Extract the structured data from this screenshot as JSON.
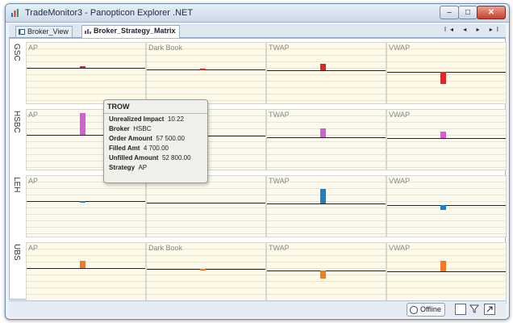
{
  "window": {
    "title": "TradeMonitor3 - Panopticon Explorer .NET",
    "minimize_label": "–",
    "maximize_label": "□",
    "close_label": "✕"
  },
  "tabs": [
    {
      "label": "Broker_View",
      "active": false
    },
    {
      "label": "Broker_Strategy_Matrix",
      "active": true
    }
  ],
  "tab_nav": "I◂ ◂ ▸ ▸I",
  "rows": [
    {
      "label": "GSC",
      "color": "#e0242c"
    },
    {
      "label": "HSBC",
      "color": "#d25fd0"
    },
    {
      "label": "LEH",
      "color": "#1f7fc0"
    },
    {
      "label": "UBS",
      "color": "#f27a20"
    }
  ],
  "columns": [
    "AP",
    "Dark Book",
    "TWAP",
    "VWAP"
  ],
  "matrix_values": {
    "GSC": {
      "AP": 1.0,
      "Dark Book": 0.3,
      "TWAP": 3.0,
      "VWAP": -5.8
    },
    "HSBC": {
      "AP": 10.22,
      "Dark Book": 0,
      "TWAP": 4.0,
      "VWAP": 3.0
    },
    "LEH": {
      "AP": 0.1,
      "Dark Book": 0,
      "TWAP": 7.2,
      "VWAP": -2.5
    },
    "UBS": {
      "AP": 3.5,
      "Dark Book": 0.1,
      "TWAP": -4.0,
      "VWAP": 5.2
    }
  },
  "tooltip": {
    "header": "TROW",
    "fields": [
      {
        "label": "Unrealized Impact",
        "value": "10.22"
      },
      {
        "label": "Broker",
        "value": "HSBC"
      },
      {
        "label": "Order Amount",
        "value": "57 500.00"
      },
      {
        "label": "Filled Amt",
        "value": "4 700.00"
      },
      {
        "label": "Unfilled Amount",
        "value": "52 800.00"
      },
      {
        "label": "Strategy",
        "value": "AP"
      }
    ]
  },
  "status": {
    "offline_label": "Offline"
  }
}
